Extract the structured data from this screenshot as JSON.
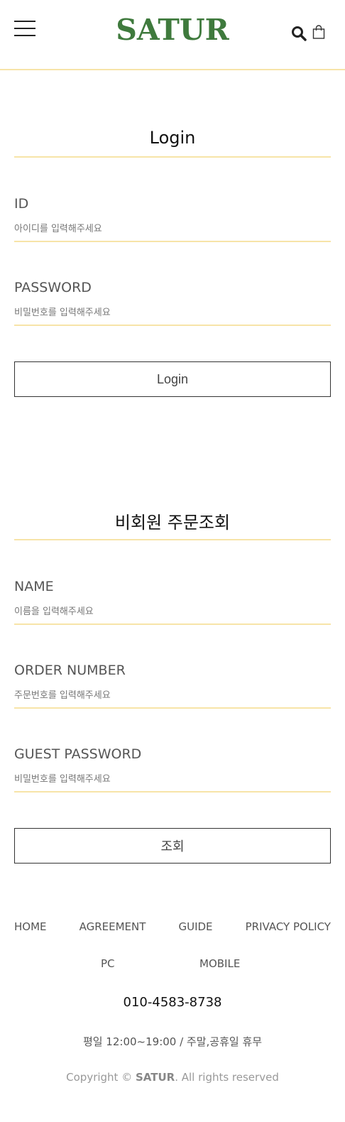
{
  "header": {
    "logo": "SATUR",
    "menu_icon": "hamburger-menu-icon",
    "search_icon": "search-icon",
    "cart_icon": "shopping-bag-icon",
    "logo_color": "#3f7a3d",
    "accent_color": "#f7e4a8"
  },
  "login": {
    "title": "Login",
    "id_label": "ID",
    "id_placeholder": "아이디를 입력해주세요",
    "password_label": "PASSWORD",
    "password_placeholder": "비밀번호를 입력해주세요",
    "button": "Login"
  },
  "guest": {
    "title": "비회원 주문조회",
    "name_label": "NAME",
    "name_placeholder": "이름을 입력해주세요",
    "order_label": "ORDER NUMBER",
    "order_placeholder": "주문번호를 입력해주세요",
    "guest_password_label": "GUEST PASSWORD",
    "guest_password_placeholder": "비밀번호를 입력해주세요",
    "button": "조회"
  },
  "footer": {
    "nav": [
      "HOME",
      "AGREEMENT",
      "GUIDE",
      "PRIVACY POLICY"
    ],
    "nav2": [
      "PC",
      "MOBILE"
    ],
    "phone": "010-4583-8738",
    "hours": "평일 12:00~19:00 / 주말,공휴일 휴무",
    "copyright_prefix": "Copyright © ",
    "copyright_brand": "SATUR",
    "copyright_suffix": ". All rights reserved"
  }
}
